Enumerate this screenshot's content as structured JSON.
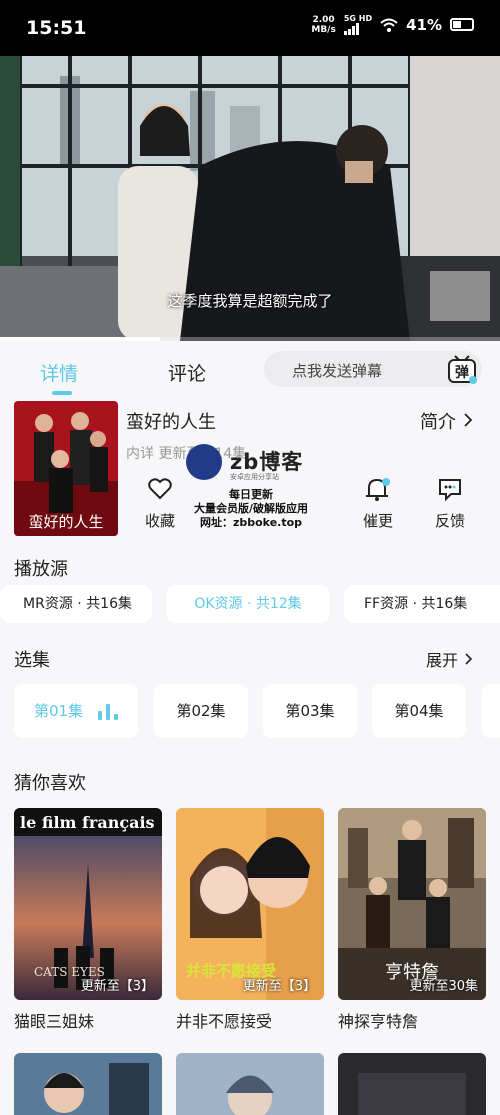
{
  "status_bar": {
    "time": "15:51",
    "speed_value": "2.00",
    "speed_unit": "MB/s",
    "network_top": "5G HD",
    "battery": "41%",
    "icons": [
      "signal-icon",
      "wifi-icon",
      "battery-icon"
    ]
  },
  "player": {
    "subtitle": "这季度我算是超额完成了",
    "progress": 0.32
  },
  "tabs": {
    "details": "详情",
    "comments": "评论",
    "danmaku_placeholder": "点我发送弹幕",
    "danmaku_icon_text": "弹"
  },
  "show": {
    "title": "蛮好的人生",
    "meta": "内详  更新至第14集",
    "intro": "简介",
    "poster_title": "蛮好的人生",
    "actions": [
      {
        "label": "收藏",
        "icon": "heart-icon"
      },
      {
        "label": "催更",
        "icon": "bell-icon"
      },
      {
        "label": "反馈",
        "icon": "feedback-icon"
      }
    ]
  },
  "watermark": {
    "name": "zb博客",
    "sub": "安卓应用分享站",
    "line1": "每日更新",
    "line2": "大量会员版/破解版应用",
    "line3": "网址：zbboke.top"
  },
  "sources": {
    "title": "播放源",
    "items": [
      {
        "name": "MR资源",
        "count": "· 共16集",
        "active": false
      },
      {
        "name": "OK资源",
        "count": "· 共12集",
        "active": true
      },
      {
        "name": "FF资源",
        "count": "· 共16集",
        "active": false
      }
    ]
  },
  "episodes": {
    "title": "选集",
    "expand": "展开",
    "items": [
      "第01集",
      "第02集",
      "第03集",
      "第04集"
    ],
    "active_index": 0
  },
  "recommend": {
    "title": "猜你喜欢",
    "items": [
      {
        "title": "猫眼三姐妹",
        "badge": "更新至【3】",
        "poster_text": "le film français",
        "poster_sub": "CATS EYES"
      },
      {
        "title": "并非不愿接受",
        "badge": "更新至【3】",
        "poster_text": "并非不愿接受"
      },
      {
        "title": "神探亨特詹",
        "badge": "更新至30集",
        "poster_text": "亨特詹"
      }
    ]
  },
  "colors": {
    "accent": "#5fc9e6",
    "background": "#f7f7f9",
    "card": "#ffffff"
  }
}
